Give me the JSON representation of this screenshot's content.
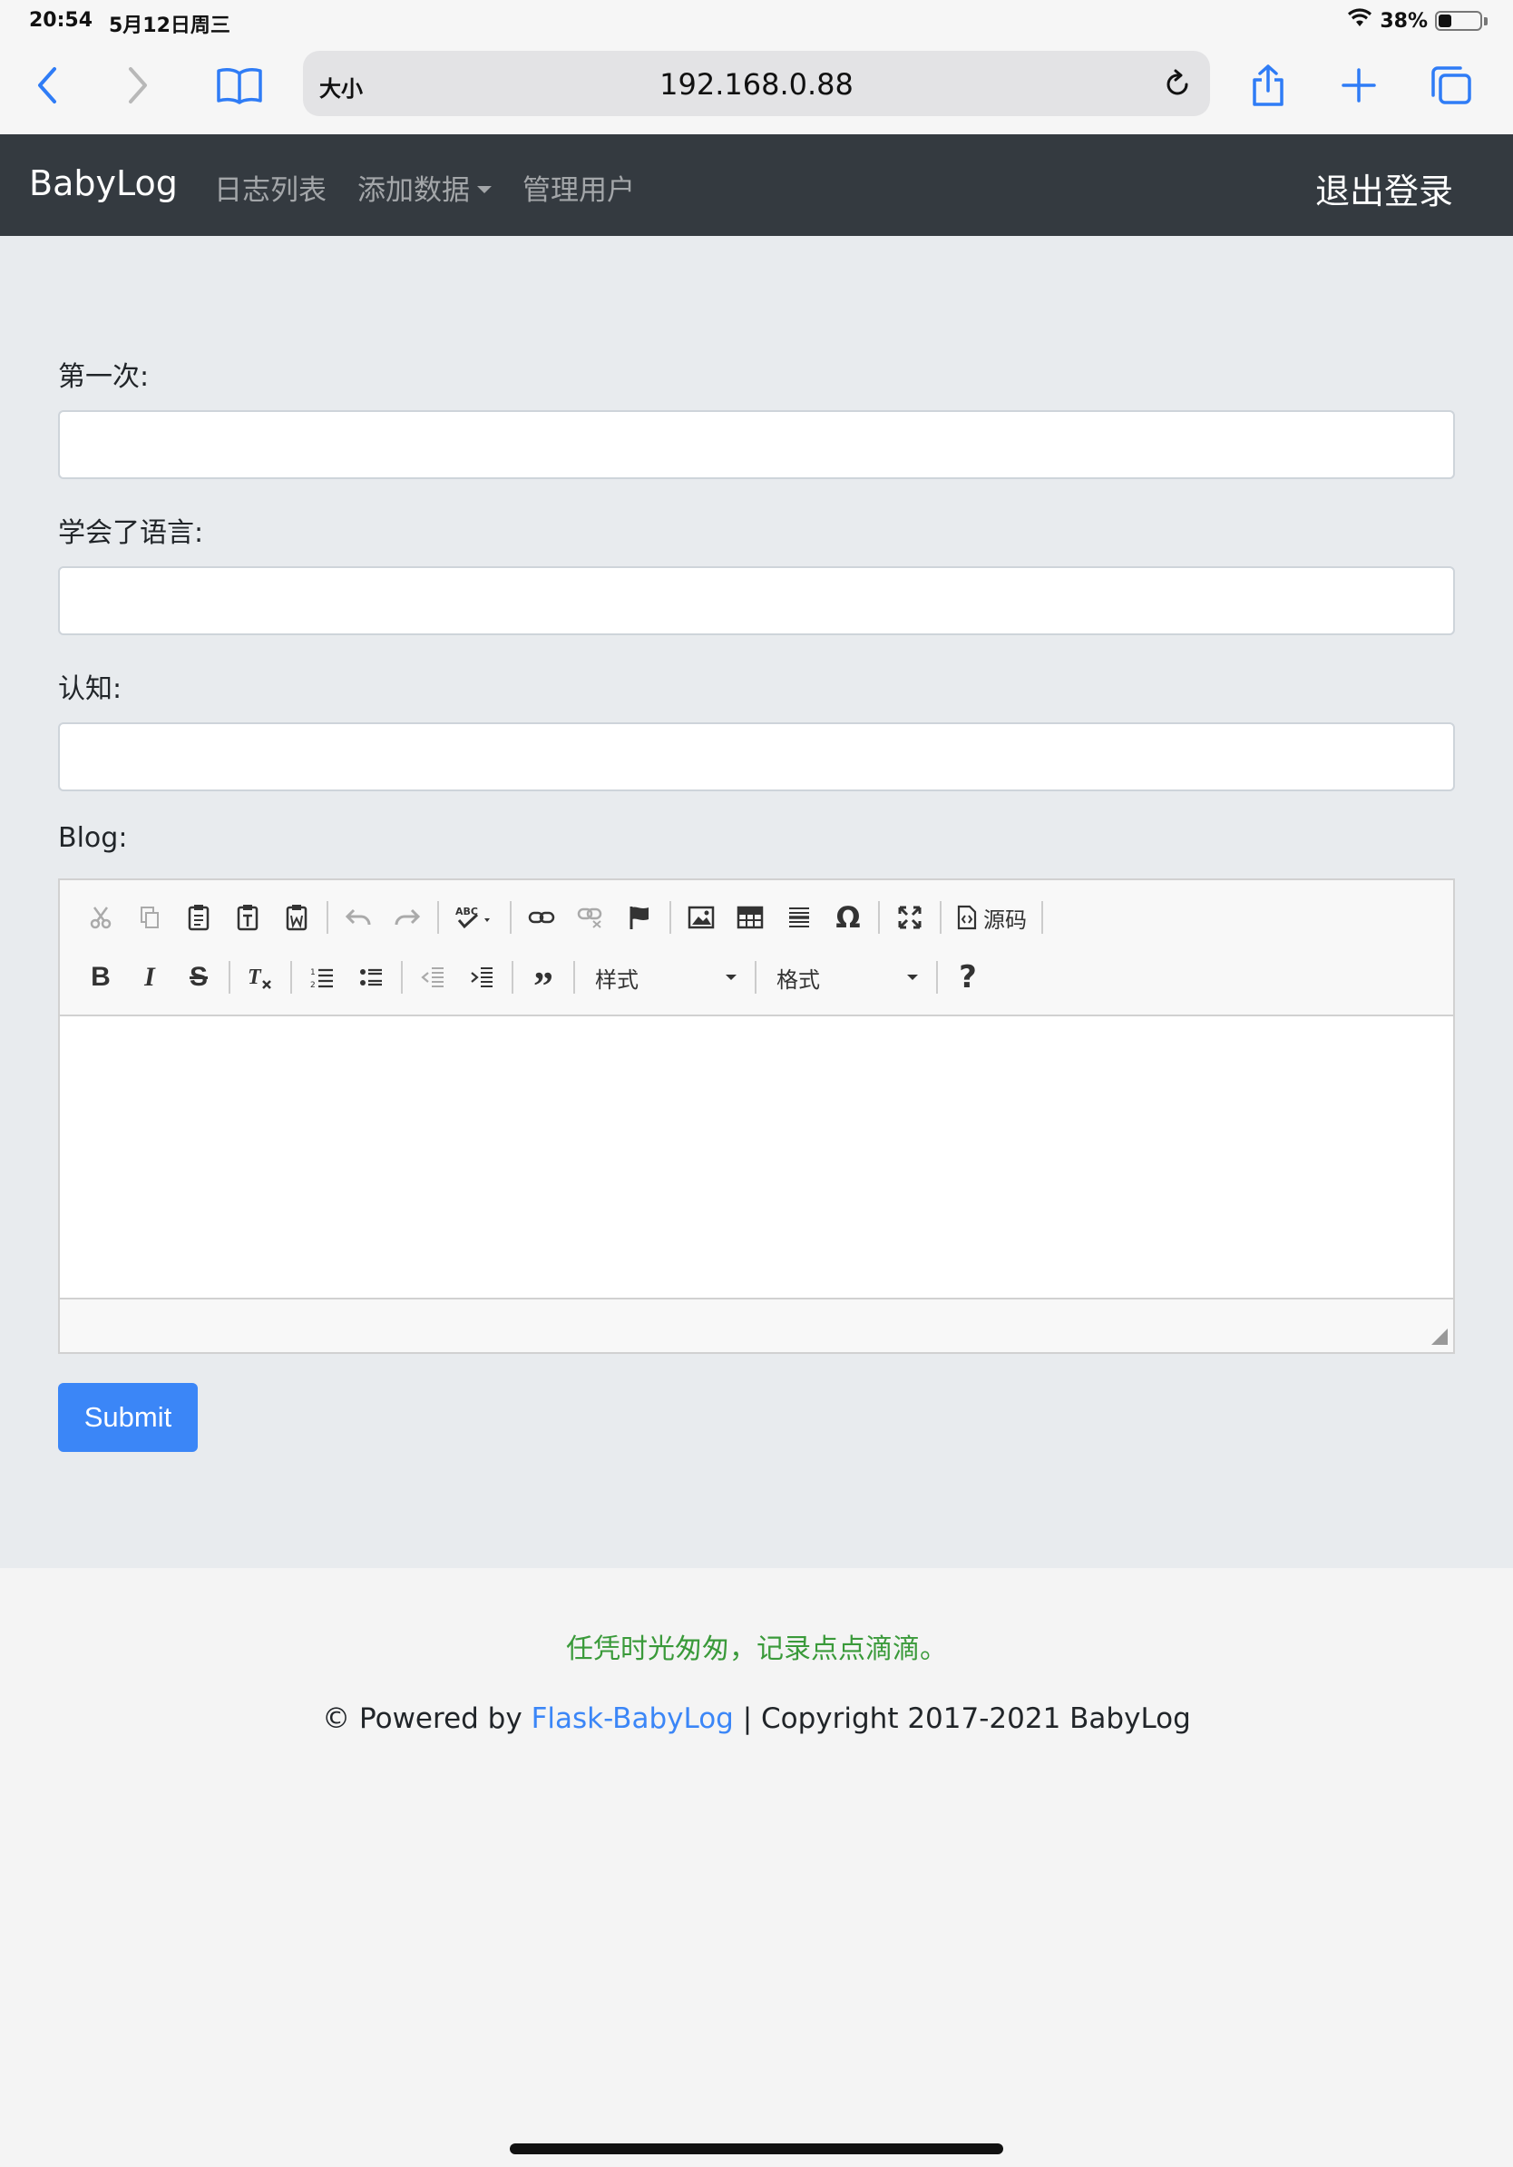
{
  "status_bar": {
    "time": "20:54",
    "date": "5月12日周三",
    "battery": "38%",
    "battery_level": 0.38
  },
  "browser": {
    "text_size_label": "大小",
    "url": "192.168.0.88",
    "buttons": [
      "back",
      "forward",
      "bookmarks",
      "reload",
      "share",
      "new-tab",
      "tabs"
    ]
  },
  "navbar": {
    "brand": "BabyLog",
    "links": [
      "日志列表",
      "添加数据",
      "管理用户"
    ],
    "logout": "退出登录"
  },
  "form": {
    "fields": [
      {
        "label": "第一次:",
        "value": ""
      },
      {
        "label": "学会了语言:",
        "value": ""
      },
      {
        "label": "认知:",
        "value": ""
      }
    ],
    "blog_label": "Blog:",
    "editor": {
      "source_label": "源码",
      "styles_label": "样式",
      "format_label": "格式",
      "help_label": "?"
    },
    "submit_label": "Submit"
  },
  "footer": {
    "tagline": "任凭时光匆匆，记录点点滴滴。",
    "prefix": "© Powered by ",
    "link": "Flask-BabyLog",
    "suffix": " | Copyright 2017-2021 BabyLog"
  },
  "colors": {
    "navbar": "#343a40",
    "accent": "#3b86f7",
    "tagline": "#3a9a3a",
    "main_bg": "#e8ebee"
  }
}
